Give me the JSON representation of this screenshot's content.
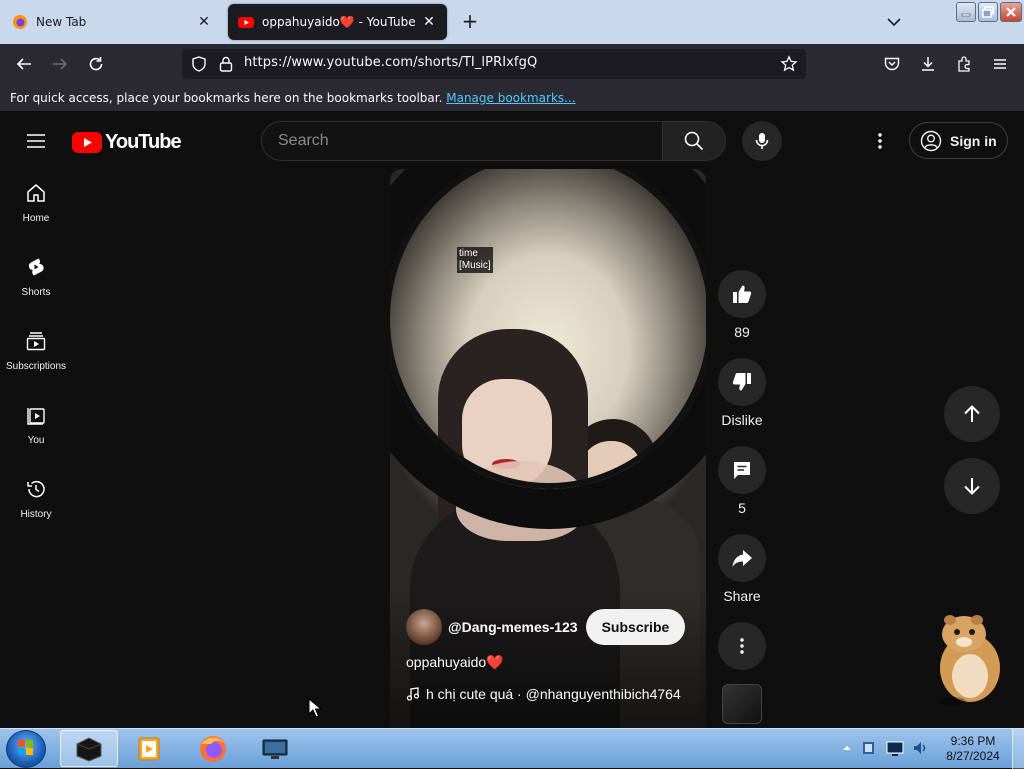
{
  "browser": {
    "tabs": [
      {
        "label": "New Tab",
        "active": false
      },
      {
        "label": "oppahuyaido❤️ - YouTube",
        "active": true
      }
    ],
    "url": "https://www.youtube.com/shorts/TI_lPRIxfgQ",
    "bookmarks_bar": {
      "message": "For quick access, place your bookmarks here on the bookmarks toolbar.",
      "link": "Manage bookmarks..."
    }
  },
  "youtube": {
    "logo_text": "YouTube",
    "search_placeholder": "Search",
    "signin_label": "Sign in",
    "guide": [
      {
        "label": "Home",
        "icon": "home-icon"
      },
      {
        "label": "Shorts",
        "icon": "shorts-icon"
      },
      {
        "label": "Subscriptions",
        "icon": "subscriptions-icon"
      },
      {
        "label": "You",
        "icon": "you-icon"
      },
      {
        "label": "History",
        "icon": "history-icon"
      }
    ],
    "short": {
      "caption_lines": [
        "time",
        "[Music]"
      ],
      "channel": "@Dang-memes-123",
      "subscribe_label": "Subscribe",
      "title": "oppahuyaido",
      "title_emoji": "❤️",
      "sound": "h chị cute quá · @nhanguyenthibich4764"
    },
    "actions": {
      "like_count": "89",
      "dislike_label": "Dislike",
      "comment_count": "5",
      "share_label": "Share"
    }
  },
  "taskbar": {
    "clock_time": "9:36 PM",
    "clock_date": "8/27/2024"
  },
  "colors": {
    "youtube_red": "#ff0000",
    "accent_link": "#50c7ff",
    "page_bg": "#0f0f0f"
  }
}
